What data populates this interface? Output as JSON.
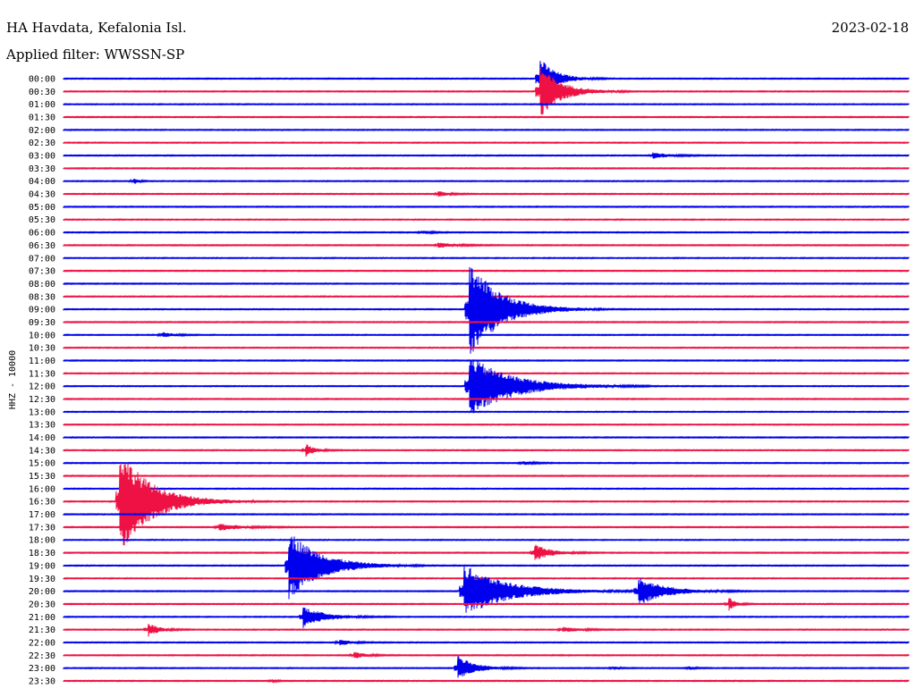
{
  "header": {
    "station": "HA Havdata, Kefalonia Isl.",
    "date": "2023-02-18",
    "filter": "Applied filter: WWSSN-SP"
  },
  "colors": {
    "even_row": "#0000ee",
    "odd_row": "#ee1144",
    "text": "#000000",
    "background": "#ffffff"
  },
  "chart_data": {
    "type": "helicorder",
    "ylabel": "HHZ - 10000",
    "row_minutes": 30,
    "x_minutes": [
      0,
      30
    ],
    "rows": [
      "00:00",
      "00:30",
      "01:00",
      "01:30",
      "02:00",
      "02:30",
      "03:00",
      "03:30",
      "04:00",
      "04:30",
      "05:00",
      "05:30",
      "06:00",
      "06:30",
      "07:00",
      "07:30",
      "08:00",
      "08:30",
      "09:00",
      "09:30",
      "10:00",
      "10:30",
      "11:00",
      "11:30",
      "12:00",
      "12:30",
      "13:00",
      "13:30",
      "14:00",
      "14:30",
      "15:00",
      "15:30",
      "16:00",
      "16:30",
      "17:00",
      "17:30",
      "18:00",
      "18:30",
      "19:00",
      "19:30",
      "20:00",
      "20:30",
      "21:00",
      "21:30",
      "22:00",
      "22:30",
      "23:00",
      "23:30"
    ],
    "events": [
      {
        "row": 0,
        "minute": 16.9,
        "amp": 2.4,
        "dur": 1.5
      },
      {
        "row": 1,
        "minute": 16.9,
        "amp": 3.0,
        "dur": 2.0
      },
      {
        "row": 6,
        "minute": 20.9,
        "amp": 0.35,
        "dur": 1.5
      },
      {
        "row": 8,
        "minute": 2.5,
        "amp": 0.35,
        "dur": 0.4
      },
      {
        "row": 9,
        "minute": 13.3,
        "amp": 0.35,
        "dur": 0.8
      },
      {
        "row": 12,
        "minute": 12.7,
        "amp": 0.2,
        "dur": 0.8
      },
      {
        "row": 13,
        "minute": 13.3,
        "amp": 0.3,
        "dur": 1.5
      },
      {
        "row": 18,
        "minute": 14.4,
        "amp": 5.5,
        "dur": 3.0
      },
      {
        "row": 20,
        "minute": 3.5,
        "amp": 0.3,
        "dur": 1.0
      },
      {
        "row": 24,
        "minute": 14.4,
        "amp": 3.5,
        "dur": 4.0
      },
      {
        "row": 29,
        "minute": 8.6,
        "amp": 0.7,
        "dur": 0.8
      },
      {
        "row": 30,
        "minute": 16.3,
        "amp": 0.2,
        "dur": 1.0
      },
      {
        "row": 33,
        "minute": 2.0,
        "amp": 6.0,
        "dur": 3.0
      },
      {
        "row": 35,
        "minute": 5.5,
        "amp": 0.4,
        "dur": 2.0
      },
      {
        "row": 37,
        "minute": 16.7,
        "amp": 1.0,
        "dur": 1.5
      },
      {
        "row": 38,
        "minute": 8.0,
        "amp": 4.0,
        "dur": 3.0
      },
      {
        "row": 40,
        "minute": 14.2,
        "amp": 3.0,
        "dur": 4.0
      },
      {
        "row": 40,
        "minute": 20.4,
        "amp": 1.6,
        "dur": 2.5
      },
      {
        "row": 41,
        "minute": 23.6,
        "amp": 0.8,
        "dur": 0.6
      },
      {
        "row": 42,
        "minute": 8.5,
        "amp": 1.2,
        "dur": 2.0
      },
      {
        "row": 43,
        "minute": 3.0,
        "amp": 0.8,
        "dur": 1.0
      },
      {
        "row": 43,
        "minute": 17.7,
        "amp": 0.3,
        "dur": 1.5
      },
      {
        "row": 44,
        "minute": 9.8,
        "amp": 0.4,
        "dur": 1.0
      },
      {
        "row": 45,
        "minute": 10.3,
        "amp": 0.4,
        "dur": 1.0
      },
      {
        "row": 46,
        "minute": 14.0,
        "amp": 1.5,
        "dur": 1.5
      },
      {
        "row": 46,
        "minute": 19.5,
        "amp": 0.2,
        "dur": 0.5
      },
      {
        "row": 46,
        "minute": 22.2,
        "amp": 0.2,
        "dur": 0.5
      },
      {
        "row": 47,
        "minute": 7.4,
        "amp": 0.2,
        "dur": 0.4
      }
    ]
  }
}
